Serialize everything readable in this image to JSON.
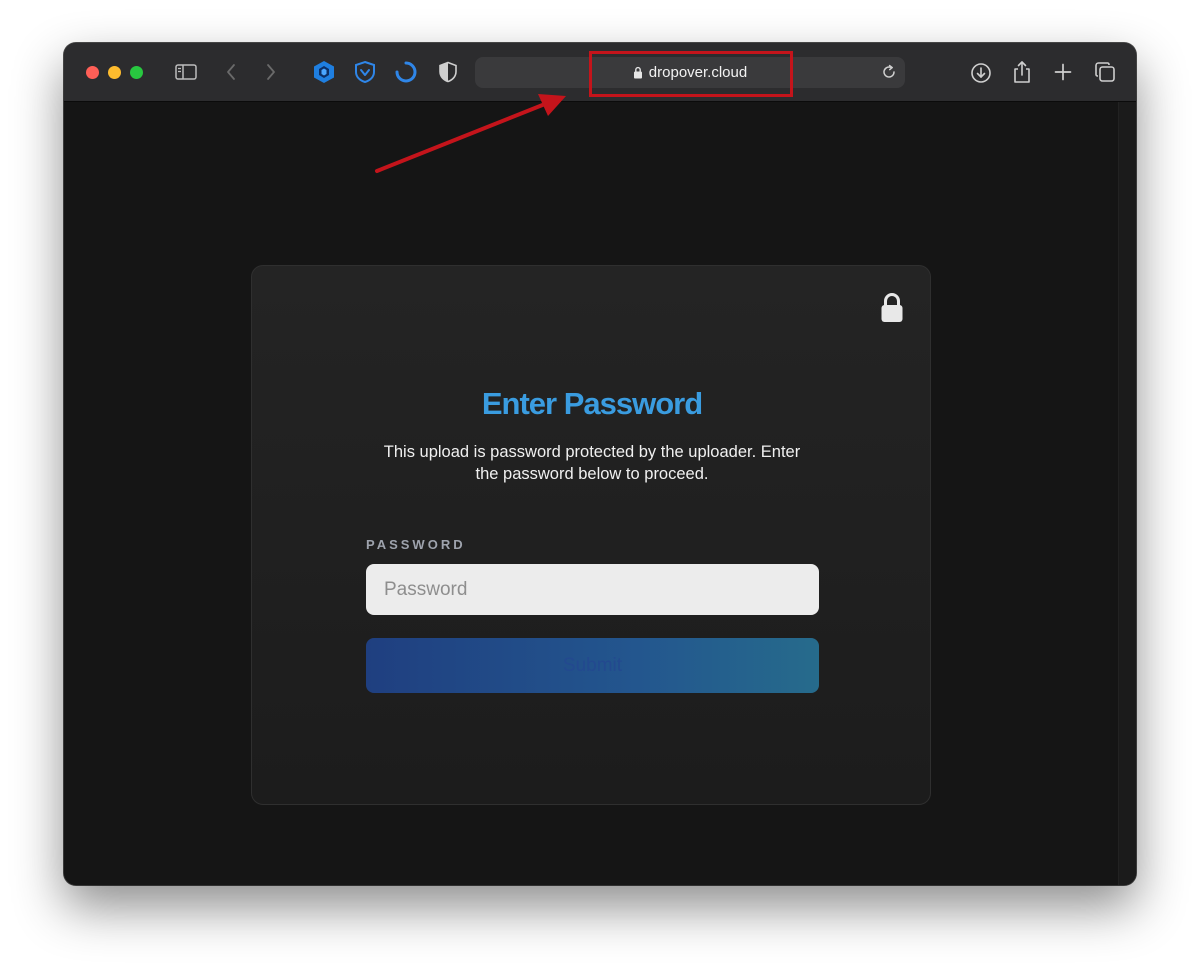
{
  "browser": {
    "url": "dropover.cloud",
    "accent_colors": {
      "close": "#ff5f57",
      "minimize": "#febc2e",
      "zoom": "#28c840"
    },
    "toolbar_icons": [
      "sidebar-icon",
      "back-icon",
      "forward-icon",
      "hexagon-extension-icon",
      "shield-extension-icon",
      "spinner-extension-icon",
      "privacy-shield-icon",
      "download-icon",
      "share-icon",
      "new-tab-icon",
      "tab-overview-icon"
    ]
  },
  "card": {
    "title": "Enter Password",
    "description": "This upload is password protected by the uploader. Enter the password below to proceed.",
    "field_label": "PASSWORD",
    "password_placeholder": "Password",
    "password_value": "",
    "submit_label": "Submit",
    "title_color": "#3a9ce0"
  },
  "annotation": {
    "highlight_color": "#c4141b"
  }
}
